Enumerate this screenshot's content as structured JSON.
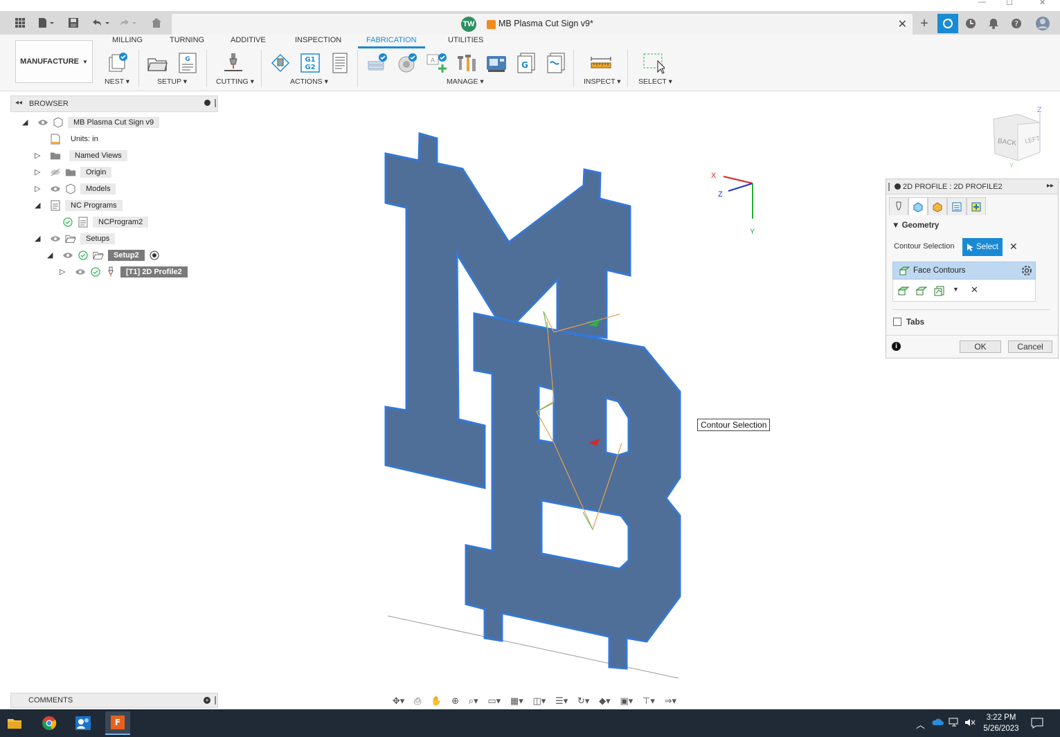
{
  "window": {
    "minimize": "—",
    "maximize": "☐",
    "close": "✕"
  },
  "titlebar": {
    "user_initials": "TW",
    "document_title": "MB Plasma Cut Sign v9*",
    "close_tab": "✕",
    "add_tab": "+"
  },
  "toolbar": {
    "workspace": "MANUFACTURE",
    "tabs": [
      "MILLING",
      "TURNING",
      "ADDITIVE",
      "INSPECTION",
      "FABRICATION",
      "UTILITIES"
    ],
    "active_tab": "FABRICATION",
    "groups": {
      "nest": "NEST",
      "setup": "SETUP",
      "cutting": "CUTTING",
      "actions": "ACTIONS",
      "manage": "MANAGE",
      "inspect": "INSPECT",
      "select": "SELECT"
    },
    "g1g2_top": "G1",
    "g1g2_bottom": "G2",
    "post_letter": "G"
  },
  "browser": {
    "title": "BROWSER",
    "items": [
      {
        "label": "MB Plasma Cut Sign v9"
      },
      {
        "label": "Units: in"
      },
      {
        "label": "Named Views"
      },
      {
        "label": "Origin"
      },
      {
        "label": "Models"
      },
      {
        "label": "NC Programs"
      },
      {
        "label": "NCProgram2"
      },
      {
        "label": "Setups"
      },
      {
        "label": "Setup2"
      },
      {
        "label": "[T1] 2D Profile2"
      }
    ]
  },
  "viewcube": {
    "back": "BACK",
    "left": "LEFT",
    "z_axis": "Z",
    "y_axis": "Y"
  },
  "triad": {
    "x": "X",
    "y": "Y",
    "z": "Z"
  },
  "tooltip": "Contour Selection",
  "dialog": {
    "title": "2D PROFILE : 2D PROFILE2",
    "geometry_section": "Geometry",
    "contour_selection_label": "Contour Selection",
    "select_button": "Select",
    "face_contours": "Face Contours",
    "tabs_label": "Tabs",
    "ok": "OK",
    "cancel": "Cancel"
  },
  "comments": {
    "title": "COMMENTS"
  },
  "taskbar": {
    "time": "3:22 PM",
    "date": "5/26/2023"
  },
  "colors": {
    "accent": "#1a8ad4",
    "part_fill": "#4f6f98",
    "part_edge": "#3578d6"
  }
}
